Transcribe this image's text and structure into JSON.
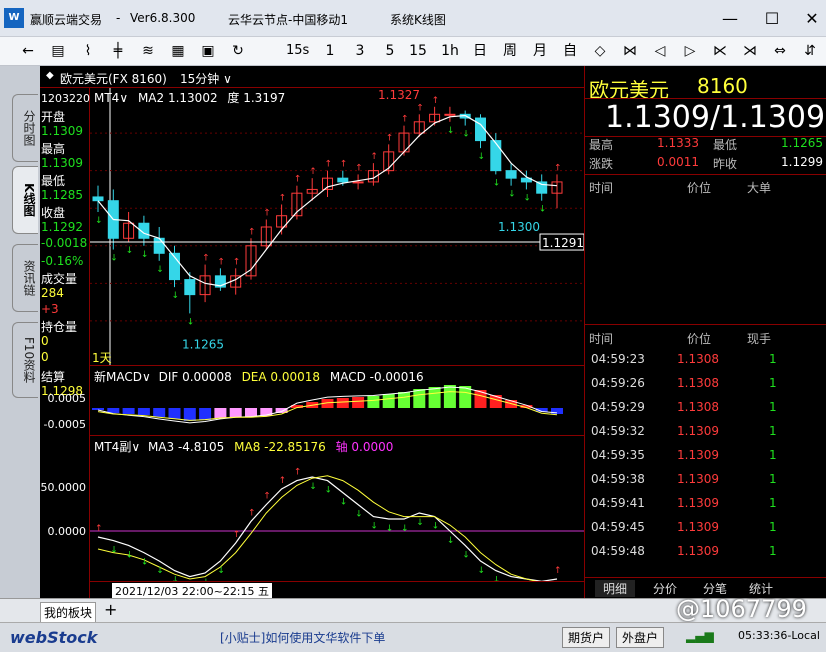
{
  "window": {
    "app_name": "赢顺云端交易",
    "version": "Ver6.8.300",
    "node": "云华云节点-中国移动1",
    "menu": "系统K线图"
  },
  "toolbar": {
    "items": [
      "back",
      "list",
      "chart",
      "candle",
      "qian",
      "table",
      "save",
      "refresh",
      "1",
      "3",
      "5",
      "15",
      "1h",
      "day",
      "week",
      "month",
      "custom",
      "zoom-in",
      "zoom-out",
      "prev",
      "next",
      "expand",
      "collapse"
    ],
    "labels": {
      "m15s": "15s",
      "m1": "1",
      "m3": "3",
      "m5": "5",
      "m15": "15",
      "h1": "1h",
      "day": "日",
      "week": "周",
      "month": "月",
      "custom": "自"
    }
  },
  "left_tabs": [
    "分时图",
    "K线图",
    "资讯链",
    "F10资料"
  ],
  "header": {
    "symbol": "欧元美元(FX 8160)",
    "period": "15分钟"
  },
  "left_panel": {
    "time": "12032200",
    "open_label": "开盘",
    "open": "1.1309",
    "high_label": "最高",
    "high": "1.1309",
    "low_label": "最低",
    "low": "1.1285",
    "close_label": "收盘",
    "close": "1.1292",
    "change": "-0.0018",
    "change_pct": "-0.16%",
    "volume_label": "成交量",
    "volume": "284",
    "volume_delta": "+3",
    "oi_label": "持仓量",
    "oi": "0",
    "oi2": "0",
    "settle_label": "结算",
    "settle": "1.1298"
  },
  "main_chart": {
    "indicator": "MT4",
    "ma2": "MA2 1.13002",
    "degree_label": "度 1.3197",
    "high_label": "1.1327",
    "low_label": "1.1265",
    "last_label": "1.1300",
    "current_price": "1.1291",
    "period_badge": "1天",
    "ticks": [
      "1.1320",
      "1.1310",
      "1.1300",
      "1.1290",
      "1.1280",
      "1.1270"
    ]
  },
  "macd_chart": {
    "indicator": "新MACD",
    "dif": "DIF 0.00008",
    "dea": "DEA 0.00018",
    "macd": "MACD -0.00016",
    "ticks": [
      "0.0005",
      "-0.0005"
    ]
  },
  "mt4_chart": {
    "indicator": "MT4副",
    "ma3": "MA3 -4.8105",
    "ma8": "MA8 -22.85176",
    "axis": "轴 0.0000",
    "ticks": [
      "50.0000",
      "0.0000",
      "-50.0000"
    ]
  },
  "date_bar": {
    "label": "2021/12/03 22:00~22:15 五"
  },
  "quote": {
    "name": "欧元美元",
    "code": "8160",
    "price": "1.1309/1.1309",
    "high_label": "最高",
    "high": "1.1333",
    "low_label": "最低",
    "low": "1.1265",
    "change_label": "涨跌",
    "change": "0.0011",
    "prev_label": "昨收",
    "prev": "1.1299"
  },
  "big_orders": {
    "headers": [
      "时间",
      "价位",
      "大单"
    ]
  },
  "trades": {
    "headers": [
      "时间",
      "价位",
      "现手"
    ],
    "rows": [
      {
        "time": "04:59:23",
        "price": "1.1308",
        "vol": "1"
      },
      {
        "time": "04:59:26",
        "price": "1.1308",
        "vol": "1"
      },
      {
        "time": "04:59:29",
        "price": "1.1308",
        "vol": "1"
      },
      {
        "time": "04:59:32",
        "price": "1.1309",
        "vol": "1"
      },
      {
        "time": "04:59:35",
        "price": "1.1309",
        "vol": "1"
      },
      {
        "time": "04:59:38",
        "price": "1.1309",
        "vol": "1"
      },
      {
        "time": "04:59:41",
        "price": "1.1309",
        "vol": "1"
      },
      {
        "time": "04:59:45",
        "price": "1.1309",
        "vol": "1"
      },
      {
        "time": "04:59:48",
        "price": "1.1309",
        "vol": "1"
      }
    ]
  },
  "right_tabs": [
    "明细",
    "分价",
    "分笔",
    "统计"
  ],
  "bottom": {
    "my_board": "我的板块",
    "add": "+"
  },
  "status": {
    "logo": "webStock",
    "tip": "[小贴士]如何使用文华软件下单",
    "btn1": "期货户",
    "btn2": "外盘户",
    "clock": "05:33:36-Local",
    "watermark": "@1067799"
  },
  "colors": {
    "up": "#ff3b3b",
    "down": "#35d6e8",
    "grid": "#800000",
    "ma": "#ffffff",
    "dif": "#ffffff",
    "dea": "#ffff3b"
  }
}
